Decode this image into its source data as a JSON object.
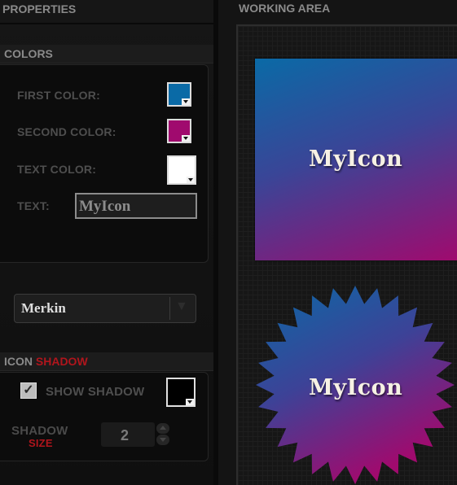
{
  "properties": {
    "title": "PROPERTIES"
  },
  "working_area": {
    "title": "WORKING AREA"
  },
  "colors": {
    "section_title": "COLORS",
    "first_label": "FIRST COLOR:",
    "first_value": "#0a6aa6",
    "second_label": "SECOND COLOR:",
    "second_value": "#a00a6e",
    "text_label": "TEXT COLOR:",
    "text_value": "#ffffff",
    "text_field_label": "TEXT:",
    "text_field_value": "MyIcon"
  },
  "font_select": {
    "selected": "Merkin",
    "arrow_icon": "triangle-down-icon"
  },
  "shadow": {
    "title_part1": "ICON",
    "title_part2": "SHADOW",
    "show_label": "SHOW SHADOW",
    "show_checked": true,
    "shadow_color": "#000000",
    "size_label_line1": "SHADOW",
    "size_label_line2": "SIZE",
    "size_value": "2"
  },
  "canvas": {
    "square_icon_text": "MyIcon",
    "star_icon_text": "MyIcon",
    "gradient_start": "#0a6aa6",
    "gradient_end": "#a00a6e"
  },
  "accent_color": "#b0151c"
}
